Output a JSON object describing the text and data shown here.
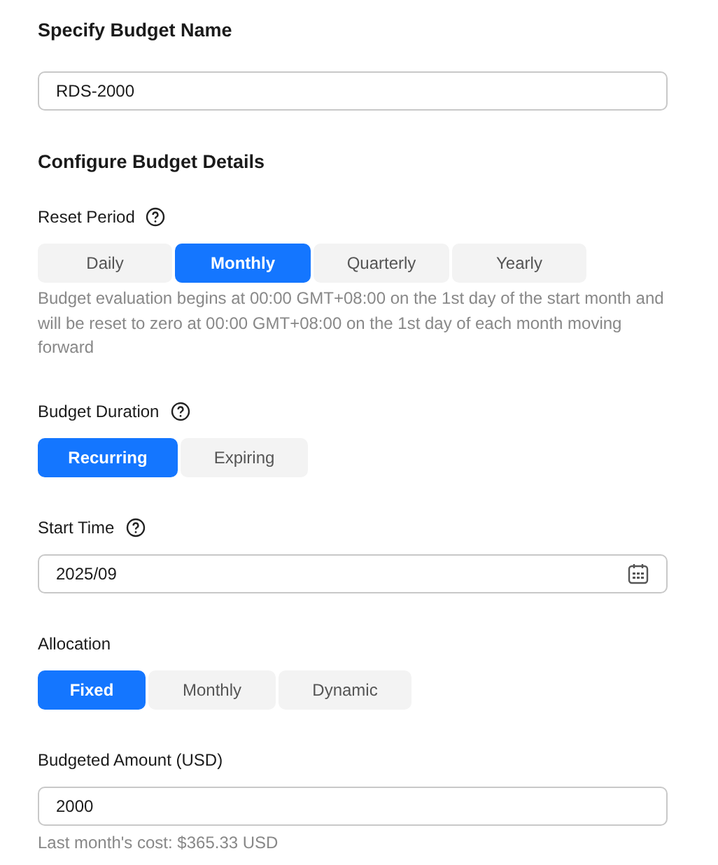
{
  "name_section": {
    "title": "Specify Budget Name",
    "field": {
      "value": "RDS-2000"
    }
  },
  "details_title": "Configure Budget Details",
  "fields": [
    {
      "kind": "segmented",
      "label": "Reset Period",
      "help": true,
      "options": [
        {
          "label": "Daily",
          "selected": false
        },
        {
          "label": "Monthly",
          "selected": true
        },
        {
          "label": "Quarterly",
          "selected": false
        },
        {
          "label": "Yearly",
          "selected": false
        }
      ],
      "note": "Budget evaluation begins at 00:00 GMT+08:00 on the 1st day of the start month and will be reset to zero at 00:00 GMT+08:00 on the 1st day of each month moving forward"
    },
    {
      "kind": "segmented",
      "label": "Budget Duration",
      "help": true,
      "options": [
        {
          "label": "Recurring",
          "selected": true
        },
        {
          "label": "Expiring",
          "selected": false
        }
      ]
    },
    {
      "kind": "date",
      "label": "Start Time",
      "help": true,
      "value": "2025/09"
    },
    {
      "kind": "segmented",
      "label": "Allocation",
      "help": false,
      "options": [
        {
          "label": "Fixed",
          "selected": true
        },
        {
          "label": "Monthly",
          "selected": false
        },
        {
          "label": "Dynamic",
          "selected": false
        }
      ]
    },
    {
      "kind": "text",
      "label": "Budgeted Amount (USD)",
      "help": false,
      "value": "2000",
      "note": "Last month's cost: $365.33 USD"
    }
  ]
}
